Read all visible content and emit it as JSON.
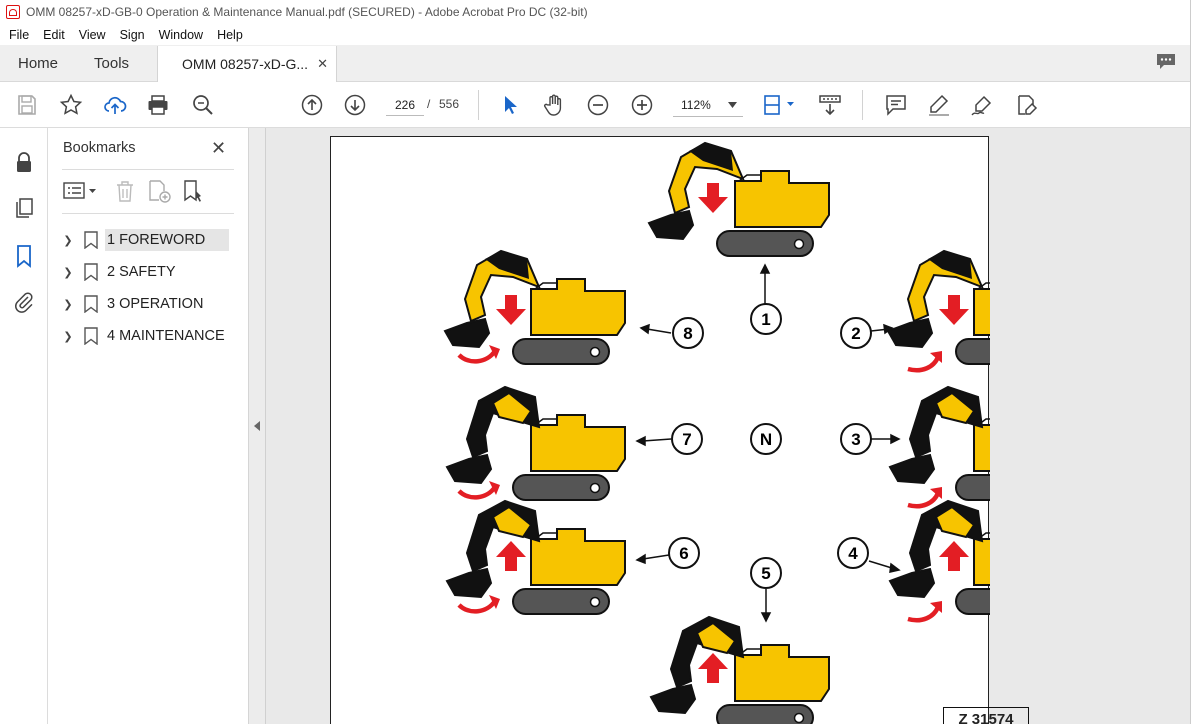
{
  "window": {
    "title": "OMM 08257-xD-GB-0 Operation & Maintenance Manual.pdf (SECURED) - Adobe Acrobat Pro DC (32-bit)"
  },
  "menu": [
    "File",
    "Edit",
    "View",
    "Sign",
    "Window",
    "Help"
  ],
  "tabs": {
    "home": "Home",
    "tools": "Tools",
    "document": "OMM 08257-xD-G...",
    "close": "✕"
  },
  "toolbar": {
    "page_current": "226",
    "page_sep": "/",
    "page_total": "556",
    "zoom": "112%"
  },
  "bookmarks": {
    "title": "Bookmarks",
    "close": "✕",
    "items": [
      {
        "label": "1 FOREWORD"
      },
      {
        "label": "2 SAFETY"
      },
      {
        "label": "3 OPERATION"
      },
      {
        "label": "4 MAINTENANCE"
      }
    ]
  },
  "figure": {
    "positions": [
      {
        "label": "1"
      },
      {
        "label": "2"
      },
      {
        "label": "3"
      },
      {
        "label": "4"
      },
      {
        "label": "5"
      },
      {
        "label": "6"
      },
      {
        "label": "7"
      },
      {
        "label": "8"
      },
      {
        "label": "N"
      }
    ],
    "reference": "Z 31574"
  },
  "colors": {
    "excavator_body": "#f7c400",
    "boom_black": "#111111",
    "arrow_red": "#e31e24",
    "track_gray": "#555555",
    "icon_blue": "#1a66c9"
  }
}
